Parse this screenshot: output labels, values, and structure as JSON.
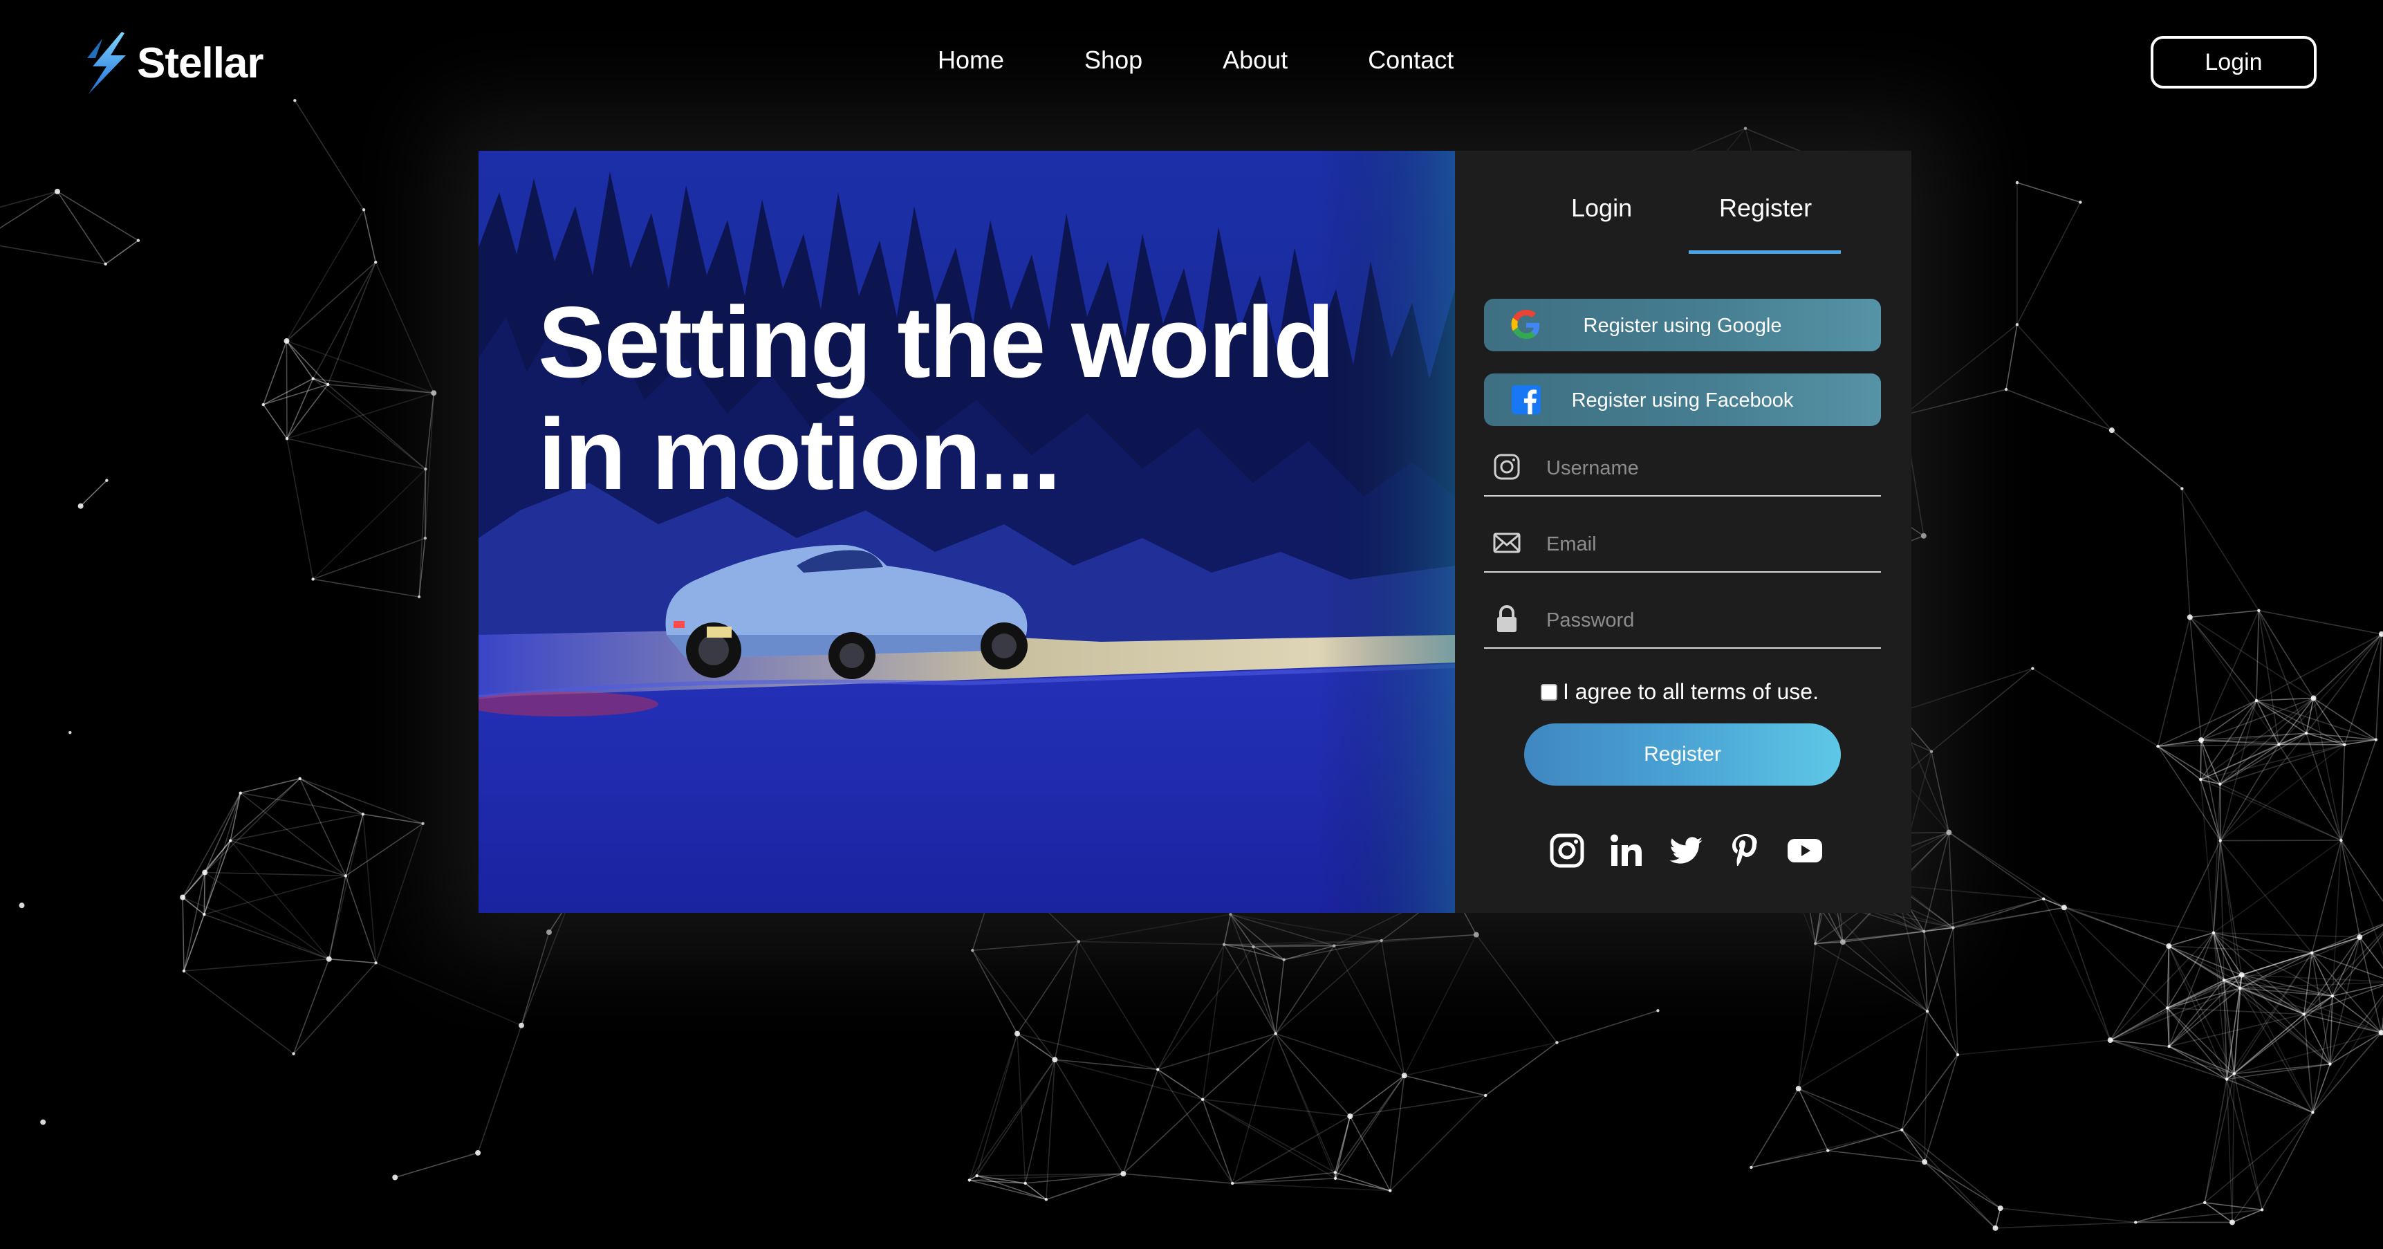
{
  "brand": {
    "name": "Stellar"
  },
  "nav": {
    "links": [
      "Home",
      "Shop",
      "About",
      "Contact"
    ],
    "login_label": "Login"
  },
  "hero": {
    "title": "Setting the world in motion..."
  },
  "auth": {
    "tabs": [
      {
        "label": "Login",
        "active": false
      },
      {
        "label": "Register",
        "active": true
      }
    ],
    "google_label": "Register using Google",
    "facebook_label": "Register using Facebook",
    "username_placeholder": "Username",
    "email_placeholder": "Email",
    "password_placeholder": "Password",
    "terms_label": "I agree to all terms of use.",
    "terms_checked": false,
    "submit_label": "Register",
    "social_icons": [
      "instagram-icon",
      "linkedin-icon",
      "twitter-icon",
      "pinterest-icon",
      "youtube-icon"
    ]
  },
  "colors": {
    "background": "#000000",
    "panel": "#1d1d1d",
    "accent": "#4aa6e8",
    "social_button": "#467d90",
    "register_gradient_start": "#3f87c0",
    "register_gradient_end": "#5ec7e6"
  }
}
